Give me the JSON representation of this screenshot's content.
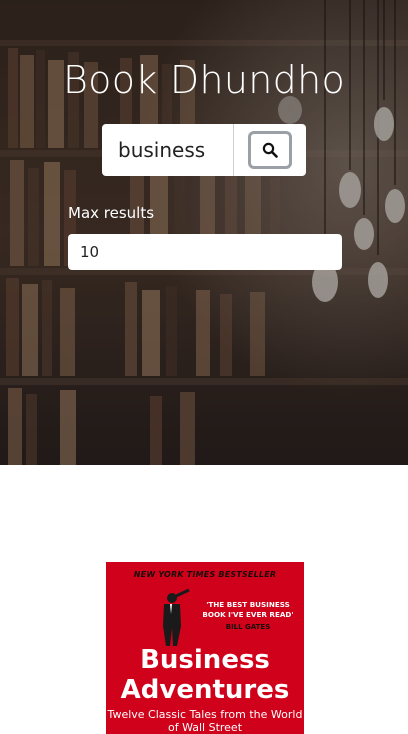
{
  "app": {
    "title": "Book Dhundho"
  },
  "search": {
    "value": "business",
    "button_icon": "search-icon"
  },
  "max_results": {
    "label": "Max results",
    "value": "10"
  },
  "results": [
    {
      "cover": {
        "top_banner": "NEW YORK TIMES BESTSELLER",
        "quote": "'THE BEST BUSINESS BOOK I'VE EVER READ'",
        "quote_author": "BILL GATES",
        "title_line1": "Business",
        "title_line2": "Adventures",
        "subtitle": "Twelve Classic Tales from the World of Wall Street",
        "color": "#d0021b"
      }
    }
  ],
  "colors": {
    "hero_overlay": "#2a1f1a",
    "accent": "#d0021b",
    "text_light": "#ffffff"
  }
}
